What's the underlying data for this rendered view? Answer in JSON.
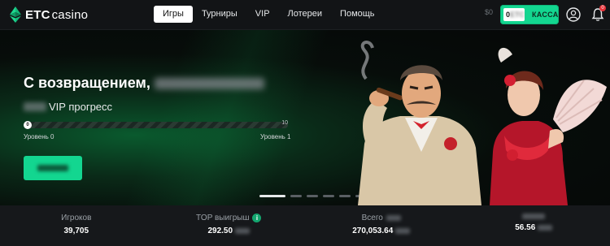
{
  "header": {
    "logo_brand": "ETC",
    "logo_suffix": "casino",
    "nav": [
      {
        "label": "Игры",
        "active": true
      },
      {
        "label": "Турниры",
        "active": false
      },
      {
        "label": "VIP",
        "active": false
      },
      {
        "label": "Лотереи",
        "active": false
      },
      {
        "label": "Помощь",
        "active": false
      }
    ],
    "balance_prefix": "$0",
    "cash_amount": "0",
    "cash_label": "КАССА",
    "notification_count": "0",
    "accent_color": "#13d690"
  },
  "hero": {
    "welcome": "С возвращением,",
    "vip_progress": "VIP прогресс",
    "progress_fraction": 0.0,
    "progress_start": "0",
    "progress_end": "10",
    "level_left": "Уровень 0",
    "level_right": "Уровень 1",
    "slides_count": 6,
    "active_slide": 0
  },
  "stats": [
    {
      "label": "Игроков",
      "value": "39,705"
    },
    {
      "label": "TOP выигрыш",
      "value": "292.50",
      "info": "i"
    },
    {
      "label": "Всего",
      "value": "270,053.64"
    },
    {
      "label": "",
      "value": "56.56"
    }
  ]
}
